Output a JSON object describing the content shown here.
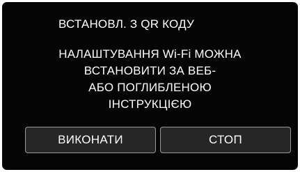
{
  "dialog": {
    "title": "ВСТАНОВЛ. З QR КОДУ",
    "message_lines": [
      "НАЛАШТУВАННЯ Wi-Fi МОЖНА",
      "ВСТАНОВИТИ ЗА ВЕБ-",
      "АБО ПОГЛИБЛЕНОЮ",
      "ІНСТРУКЦІЄЮ"
    ],
    "buttons": {
      "execute_label": "ВИКОНАТИ",
      "stop_label": "СТОП"
    }
  }
}
